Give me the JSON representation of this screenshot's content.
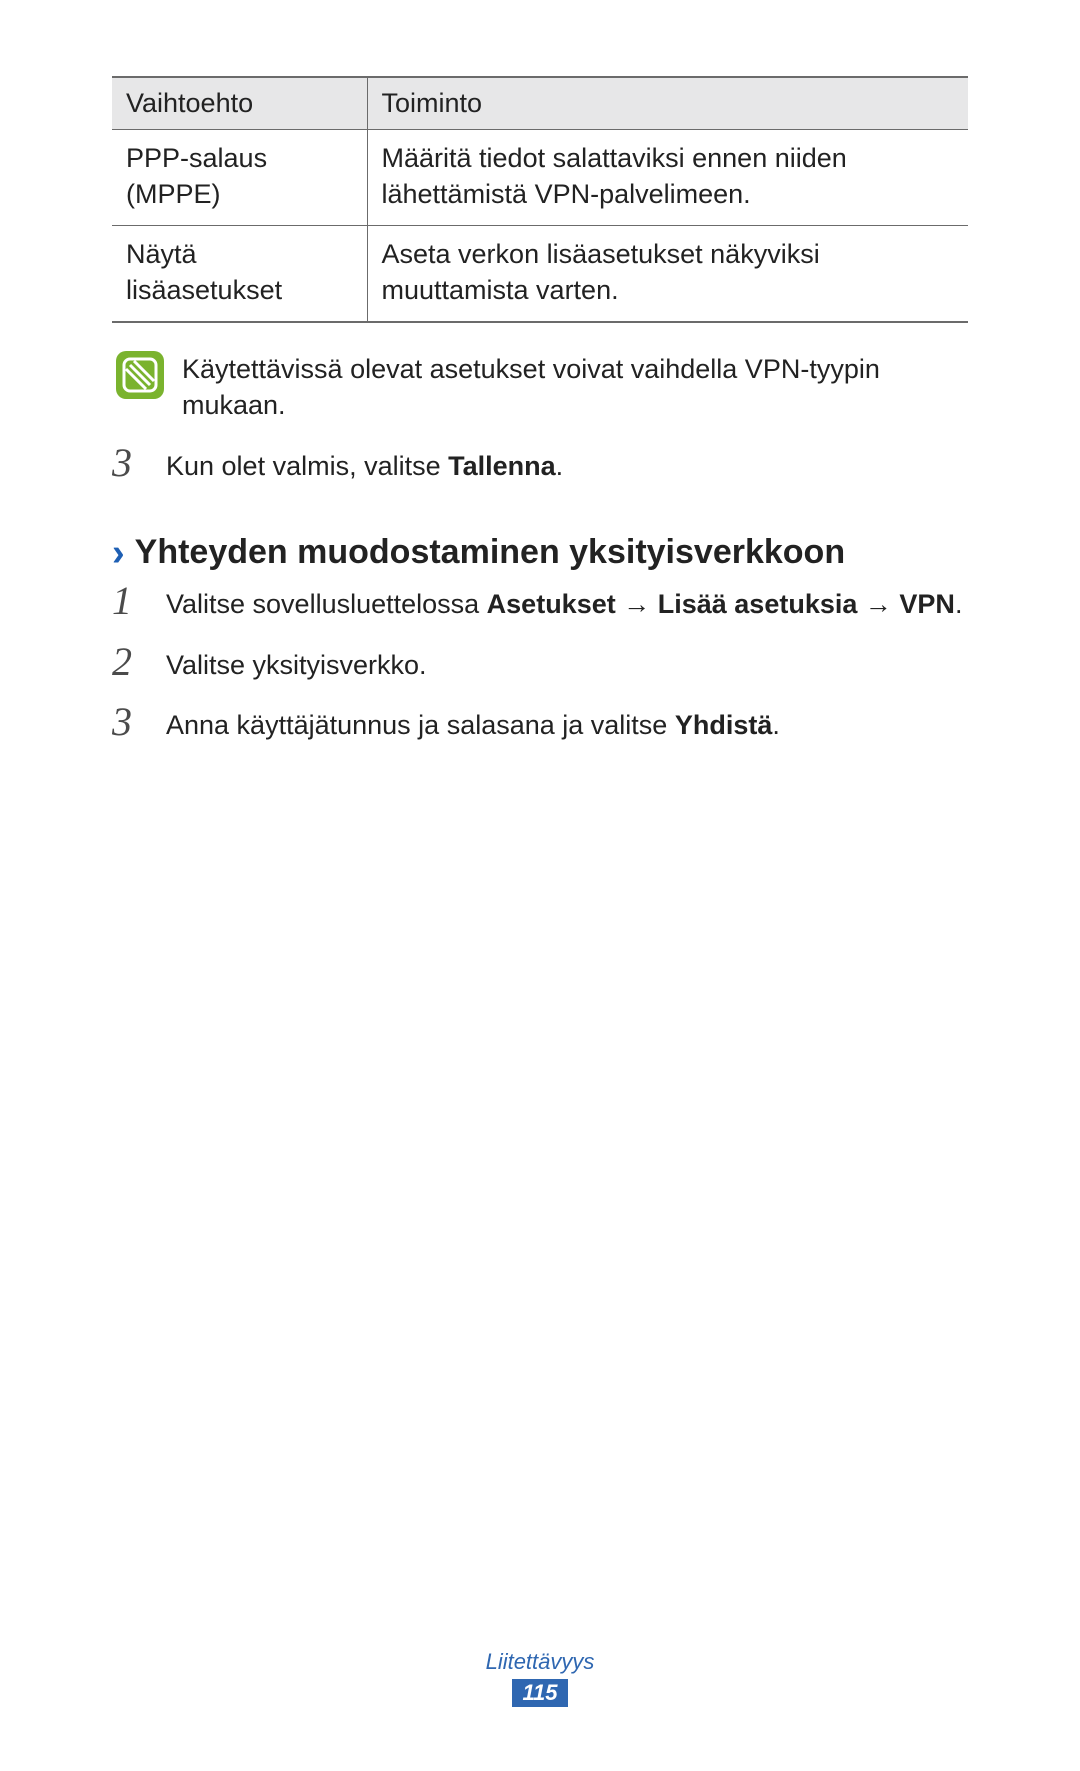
{
  "table": {
    "header": {
      "option": "Vaihtoehto",
      "function": "Toiminto"
    },
    "rows": [
      {
        "option": "PPP-salaus (MPPE)",
        "function": "Määritä tiedot salattaviksi ennen niiden lähettämistä VPN-palvelimeen."
      },
      {
        "option": "Näytä lisäasetukset",
        "function": "Aseta verkon lisäasetukset näkyviksi muuttamista varten."
      }
    ]
  },
  "note": "Käytettävissä olevat asetukset voivat vaihdella VPN-tyypin mukaan.",
  "pre_section_step": {
    "num": "3",
    "text_before": "Kun olet valmis, valitse ",
    "bold": "Tallenna",
    "text_after": "."
  },
  "section_title": "Yhteyden muodostaminen yksityisverkkoon",
  "steps": [
    {
      "num": "1",
      "parts": [
        {
          "t": "Valitse sovellusluettelossa "
        },
        {
          "t": "Asetukset",
          "b": true
        },
        {
          "t": " → "
        },
        {
          "t": "Lisää asetuksia",
          "b": true
        },
        {
          "t": " → "
        },
        {
          "t": "VPN",
          "b": true
        },
        {
          "t": "."
        }
      ]
    },
    {
      "num": "2",
      "parts": [
        {
          "t": "Valitse yksityisverkko."
        }
      ]
    },
    {
      "num": "3",
      "parts": [
        {
          "t": "Anna käyttäjätunnus ja salasana ja valitse "
        },
        {
          "t": "Yhdistä",
          "b": true
        },
        {
          "t": "."
        }
      ]
    }
  ],
  "footer": {
    "category": "Liitettävyys",
    "page": "115"
  }
}
